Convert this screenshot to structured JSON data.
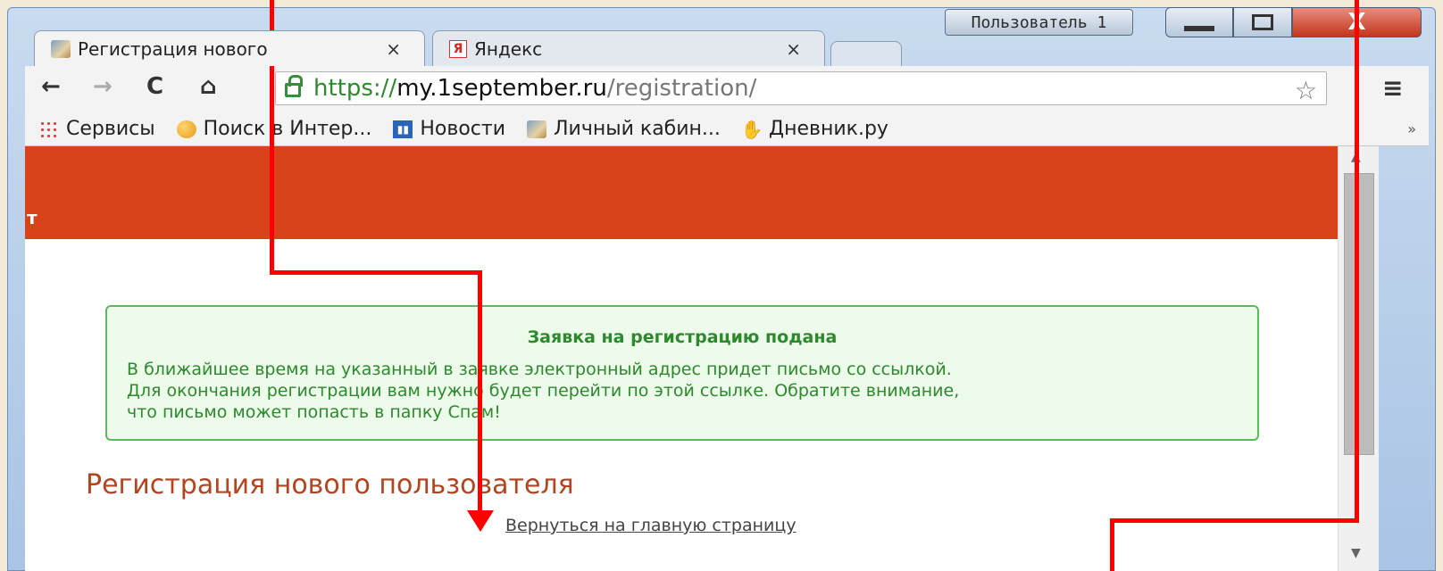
{
  "window": {
    "profile_label": "Пользователь 1",
    "close_glyph": "X"
  },
  "tabs": [
    {
      "title": "Регистрация нового",
      "close": "×"
    },
    {
      "title": "Яндекс",
      "favicon_letter": "Я",
      "close": "×"
    }
  ],
  "toolbar": {
    "back": "←",
    "forward": "→",
    "reload": "C",
    "home": "⌂",
    "url_scheme": "https://",
    "url_host": "my.1september.ru",
    "url_path": "/registration/",
    "star": "☆",
    "menu": "≡"
  },
  "bookmarks": [
    {
      "label": "Сервисы",
      "icon": "apps-icon"
    },
    {
      "label": "Поиск в Интер...",
      "icon": "search-icon"
    },
    {
      "label": "Новости",
      "icon": "news-icon"
    },
    {
      "label": "Личный кабин...",
      "icon": "cabinet-icon"
    },
    {
      "label": "Дневник.ру",
      "icon": "diary-icon"
    }
  ],
  "bookmarks_more": "»",
  "page": {
    "banner_text": "т",
    "notice_title": "Заявка на регистрацию подана",
    "notice_line1": "В ближайшее время на указанный в заявке электронный адрес придет письмо со ссылкой.",
    "notice_line2": "Для окончания регистрации вам нужно будет перейти по этой ссылке. Обратите внимание,",
    "notice_line3": "что письмо может попасть в папку Спам!",
    "heading": "Регистрация нового пользователя",
    "back_link": "Вернуться на главную страницу"
  },
  "colors": {
    "banner": "#d8431b",
    "notice_border": "#5cb85c",
    "notice_text": "#2c8a2c",
    "heading": "#b5431d",
    "annotation": "#ff0000"
  }
}
